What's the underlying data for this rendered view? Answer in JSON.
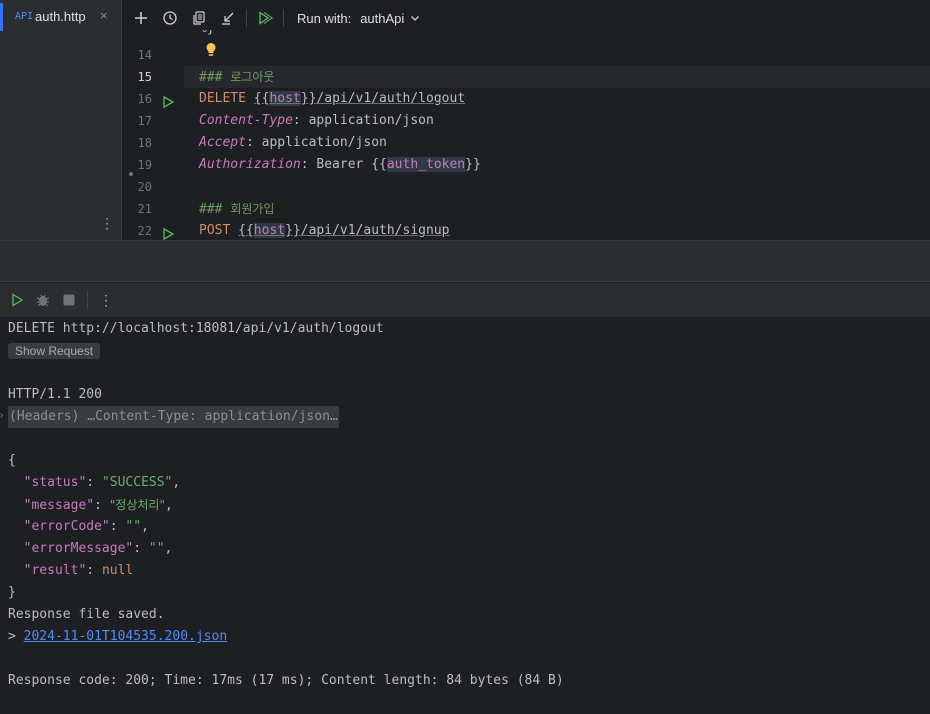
{
  "tab": {
    "icon_text": "API",
    "filename": "auth.http",
    "close": "×"
  },
  "toolbar": {
    "icons": [
      "add-icon",
      "history-icon",
      "copy-icon",
      "import-icon",
      "run-all-icon"
    ],
    "run_with_label": "Run with:",
    "environment": "authApi"
  },
  "editor": {
    "partial_top_line": "%}",
    "lines": [
      {
        "num": "14",
        "run": false
      },
      {
        "num": "15",
        "run": false,
        "active": true
      },
      {
        "num": "16",
        "run": true
      },
      {
        "num": "17",
        "run": false
      },
      {
        "num": "18",
        "run": false
      },
      {
        "num": "19",
        "run": false
      },
      {
        "num": "20",
        "run": false
      },
      {
        "num": "21",
        "run": false
      },
      {
        "num": "22",
        "run": true
      }
    ],
    "comment_1_hash": "### ",
    "comment_1_text": "로그아웃",
    "delete_method": "DELETE",
    "host_var": "host",
    "delete_path": "/api/v1/auth/logout",
    "header_content_type": "Content-Type",
    "content_type_value": "application/json",
    "header_accept": "Accept",
    "accept_value": "application/json",
    "header_authorization": "Authorization",
    "bearer_text": "Bearer ",
    "auth_token_var": "auth_token",
    "comment_2_hash": "### ",
    "comment_2_text": "회원가입",
    "post_method": "POST",
    "post_path": "/api/v1/auth/signup"
  },
  "response": {
    "request_line": "DELETE http://localhost:18081/api/v1/auth/logout",
    "show_request": "Show Request",
    "status_line": "HTTP/1.1 200",
    "headers_fold": "(Headers) …Content-Type: application/json…",
    "open_brace": "{",
    "close_brace": "}",
    "body": [
      {
        "key": "\"status\"",
        "value": "\"SUCCESS\"",
        "type": "string",
        "comma": true
      },
      {
        "key": "\"message\"",
        "value": "\"정상처리\"",
        "type": "korean",
        "comma": true
      },
      {
        "key": "\"errorCode\"",
        "value": "\"\"",
        "type": "string",
        "comma": true
      },
      {
        "key": "\"errorMessage\"",
        "value": "\"\"",
        "type": "string",
        "comma": true
      },
      {
        "key": "\"result\"",
        "value": "null",
        "type": "null",
        "comma": false
      }
    ],
    "saved_text": "Response file saved.",
    "file_prefix": "> ",
    "file_link": "2024-11-01T104535.200.json",
    "summary": "Response code: 200; Time: 17ms (17 ms); Content length: 84 bytes (84 B)"
  },
  "colors": {
    "accent": "#3574f0",
    "run_green": "#5fb865",
    "bulb": "#f2c55c"
  }
}
